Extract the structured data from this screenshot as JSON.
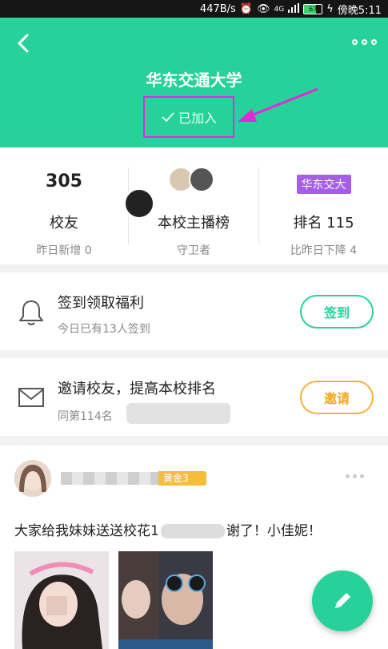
{
  "status_bar": {
    "speed": "447B/s",
    "network": "4G",
    "battery": "67",
    "time": "傍晚5:11"
  },
  "header": {
    "title": "华东交通大学",
    "joined_label": "已加入"
  },
  "stats": [
    {
      "value": "305",
      "label": "校友",
      "sub": "昨日新增 0"
    },
    {
      "label": "本校主播榜",
      "sub": "守卫者"
    },
    {
      "tag": "华东交大",
      "label": "排名 115",
      "sub": "比昨日下降 4"
    }
  ],
  "signin": {
    "title": "签到领取福利",
    "subtitle": "今日已有13人签到",
    "button": "签到"
  },
  "invite": {
    "title": "邀请校友，提高本校排名",
    "subtitle": "同第114名",
    "button": "邀请"
  },
  "post": {
    "badge": "黄金3",
    "text_before": "大家给我妹妹送送校花1",
    "text_after": "谢了！小佳妮！"
  },
  "colors": {
    "primary": "#27d29a",
    "accent": "#f4b23a",
    "highlight": "#e02ad6",
    "tag": "#a45ee8"
  },
  "icons": {
    "back": "back-arrow-icon",
    "more": "more-dots-icon",
    "bell": "bell-icon",
    "mail": "mail-icon",
    "edit": "pencil-icon"
  }
}
